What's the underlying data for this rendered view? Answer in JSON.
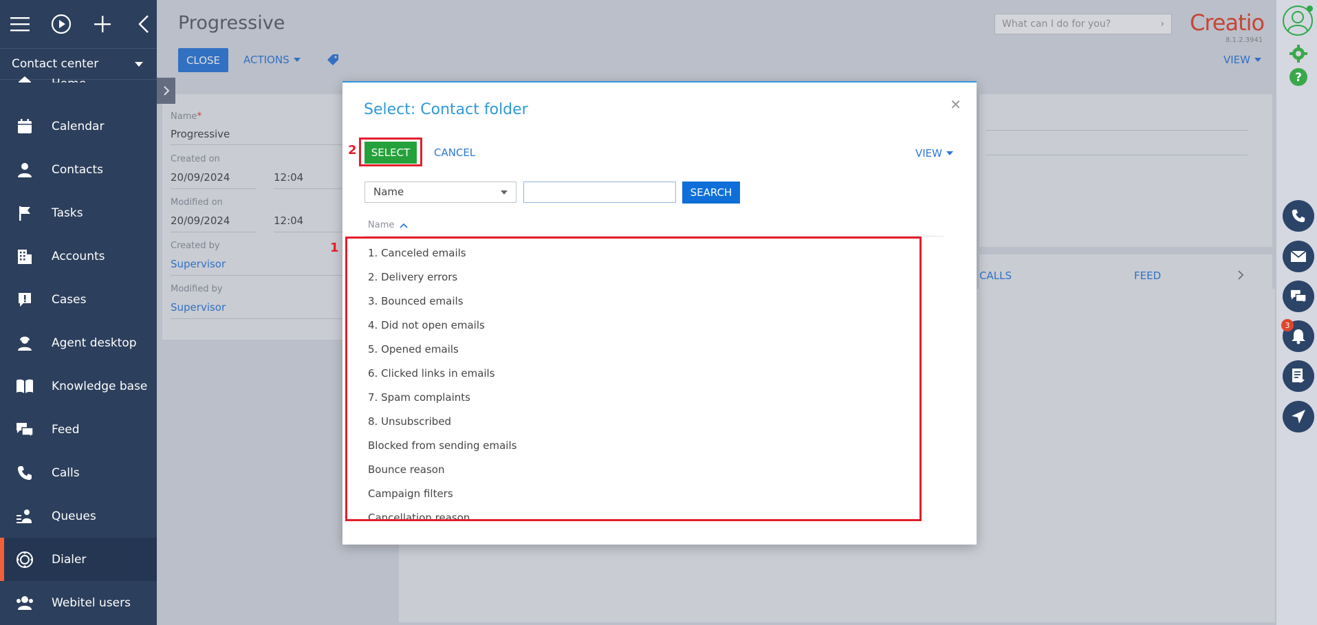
{
  "sidebar": {
    "workplace": "Contact center",
    "items": [
      {
        "label": "Home",
        "icon": "home-icon"
      },
      {
        "label": "Calendar",
        "icon": "calendar-icon"
      },
      {
        "label": "Contacts",
        "icon": "person-icon"
      },
      {
        "label": "Tasks",
        "icon": "flag-icon"
      },
      {
        "label": "Accounts",
        "icon": "building-icon"
      },
      {
        "label": "Cases",
        "icon": "exclamation-bubble-icon"
      },
      {
        "label": "Agent desktop",
        "icon": "agent-icon"
      },
      {
        "label": "Knowledge base",
        "icon": "book-icon"
      },
      {
        "label": "Feed",
        "icon": "chat-bubbles-icon"
      },
      {
        "label": "Calls",
        "icon": "phone-icon"
      },
      {
        "label": "Queues",
        "icon": "queue-icon"
      },
      {
        "label": "Dialer",
        "icon": "dialer-icon",
        "active": true
      },
      {
        "label": "Webitel users",
        "icon": "users-icon"
      }
    ]
  },
  "page": {
    "title": "Progressive",
    "close_label": "CLOSE",
    "actions_label": "ACTIONS",
    "view_label": "VIEW",
    "search_placeholder": "What can I do for you?",
    "logo": "Creatio",
    "version": "8.1.2.3941"
  },
  "record": {
    "name_label": "Name",
    "name_value": "Progressive",
    "created_on_label": "Created on",
    "created_on_date": "20/09/2024",
    "created_on_time": "12:04",
    "modified_on_label": "Modified on",
    "modified_on_date": "20/09/2024",
    "modified_on_time": "12:04",
    "created_by_label": "Created by",
    "created_by_value": "Supervisor",
    "modified_by_label": "Modified by",
    "modified_by_value": "Supervisor"
  },
  "tabs": {
    "calls": "CALLS",
    "feed": "FEED"
  },
  "rail": {
    "notification_count": "3"
  },
  "modal": {
    "title": "Select: Contact folder",
    "select_label": "SELECT",
    "cancel_label": "CANCEL",
    "view_label": "VIEW",
    "filter_column": "Name",
    "search_label": "SEARCH",
    "column_header": "Name",
    "annotation_list": "1",
    "annotation_select": "2",
    "items": [
      "1. Canceled emails",
      "2. Delivery errors",
      "3. Bounced emails",
      "4. Did not open emails",
      "5. Opened emails",
      "6. Clicked links in emails",
      "7. Spam complaints",
      "8. Unsubscribed",
      "Blocked from sending emails",
      "Bounce reason",
      "Campaign filters",
      "Cancellation reason"
    ]
  },
  "colors": {
    "sidebar_bg": "#2c3f5c",
    "accent_blue": "#2e78d7",
    "select_green": "#24a13a",
    "highlight_red": "#e31d2b",
    "brand_red": "#e0452c"
  }
}
